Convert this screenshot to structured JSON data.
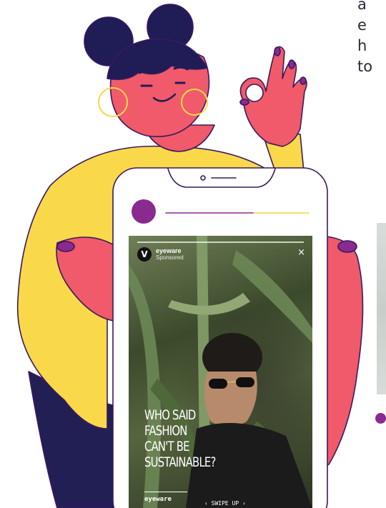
{
  "side_text": {
    "line1": "a",
    "line2": "e",
    "line3": "h",
    "line4": "to"
  },
  "story": {
    "brand_logo": "V",
    "brand_name": "eyeware",
    "sponsored_label": "Sponsored",
    "close_glyph": "×",
    "headline_lines": [
      "WHO SAID",
      "FASHION",
      "CAN'T BE",
      "SUSTAINABLE?"
    ],
    "footer_brand": "eyeware",
    "swipe_label": "‹ SWIPE UP ›"
  },
  "colors": {
    "skin": "#f05a6a",
    "sweater": "#f9d949",
    "outline": "#3a1a5e",
    "hair": "#1f1c56",
    "nails": "#8a2a8e",
    "phone": "#ffffff",
    "accent_line": "#f3d23a"
  }
}
